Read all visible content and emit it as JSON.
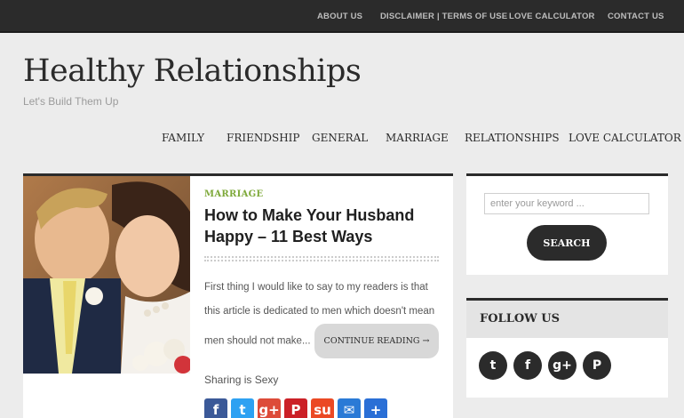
{
  "topnav": [
    "ABOUT US",
    "DISCLAIMER | TERMS OF USE",
    "LOVE CALCULATOR",
    "CONTACT US"
  ],
  "site": {
    "title": "Healthy Relationships",
    "tagline": "Let's Build Them Up"
  },
  "mainnav": [
    "FAMILY",
    "FRIENDSHIP",
    "GENERAL",
    "MARRIAGE",
    "RELATIONSHIPS",
    "LOVE CALCULATOR"
  ],
  "post": {
    "category": "MARRIAGE",
    "title": "How to Make Your Husband Happy – 11 Best Ways",
    "excerpt": "First thing I would like to say to my readers is that this article is dedicated to men which doesn't mean men should not make...",
    "more_label": "CONTINUE READING →",
    "share_text": "Sharing is Sexy",
    "share_icons": [
      {
        "icon": "facebook-icon",
        "glyph": "f",
        "color": "#3b5998"
      },
      {
        "icon": "twitter-icon",
        "glyph": "t",
        "color": "#2ea1f2"
      },
      {
        "icon": "google-plus-icon",
        "glyph": "g+",
        "color": "#dd4b39"
      },
      {
        "icon": "pinterest-icon",
        "glyph": "P",
        "color": "#cb2027"
      },
      {
        "icon": "stumbleupon-icon",
        "glyph": "su",
        "color": "#eb4924"
      },
      {
        "icon": "email-icon",
        "glyph": "✉",
        "color": "#2a7ad6"
      },
      {
        "icon": "share-plus-icon",
        "glyph": "+",
        "color": "#2a6fd6"
      }
    ]
  },
  "search": {
    "placeholder": "enter your keyword ...",
    "button_label": "SEARCH"
  },
  "follow": {
    "heading": "FOLLOW US",
    "icons": [
      {
        "icon": "twitter-icon",
        "glyph": "t"
      },
      {
        "icon": "facebook-icon",
        "glyph": "f"
      },
      {
        "icon": "google-plus-icon",
        "glyph": "g+"
      },
      {
        "icon": "pinterest-icon",
        "glyph": "P"
      }
    ]
  }
}
